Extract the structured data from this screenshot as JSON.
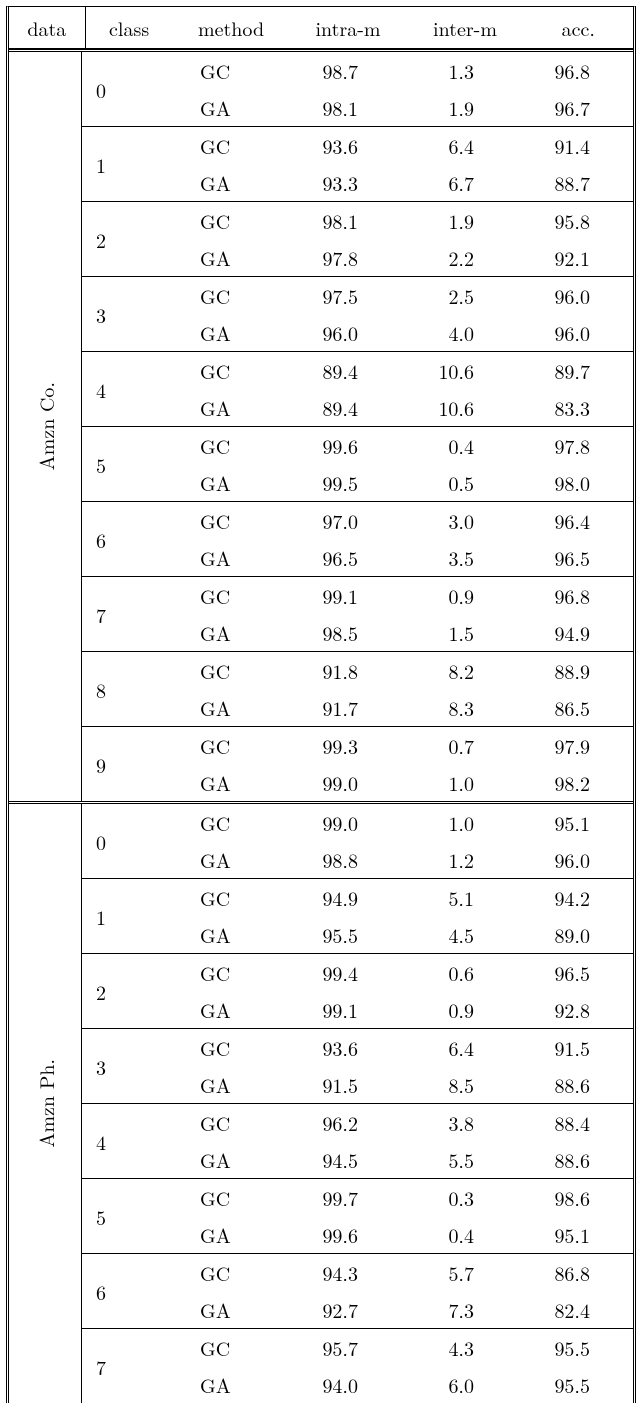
{
  "headers": {
    "data": "data",
    "class": "class",
    "method": "method",
    "intram": "intra-m",
    "interm": "inter-m",
    "acc": "acc."
  },
  "chart_data": {
    "type": "table",
    "sections": [
      {
        "data_label": "Amzn Co.",
        "groups": [
          {
            "class": "0",
            "rows": [
              {
                "method": "GC",
                "intram": "98.7",
                "interm": "1.3",
                "acc": "96.8"
              },
              {
                "method": "GA",
                "intram": "98.1",
                "interm": "1.9",
                "acc": "96.7"
              }
            ]
          },
          {
            "class": "1",
            "rows": [
              {
                "method": "GC",
                "intram": "93.6",
                "interm": "6.4",
                "acc": "91.4"
              },
              {
                "method": "GA",
                "intram": "93.3",
                "interm": "6.7",
                "acc": "88.7"
              }
            ]
          },
          {
            "class": "2",
            "rows": [
              {
                "method": "GC",
                "intram": "98.1",
                "interm": "1.9",
                "acc": "95.8"
              },
              {
                "method": "GA",
                "intram": "97.8",
                "interm": "2.2",
                "acc": "92.1"
              }
            ]
          },
          {
            "class": "3",
            "rows": [
              {
                "method": "GC",
                "intram": "97.5",
                "interm": "2.5",
                "acc": "96.0"
              },
              {
                "method": "GA",
                "intram": "96.0",
                "interm": "4.0",
                "acc": "96.0"
              }
            ]
          },
          {
            "class": "4",
            "rows": [
              {
                "method": "GC",
                "intram": "89.4",
                "interm": "10.6",
                "acc": "89.7"
              },
              {
                "method": "GA",
                "intram": "89.4",
                "interm": "10.6",
                "acc": "83.3"
              }
            ]
          },
          {
            "class": "5",
            "rows": [
              {
                "method": "GC",
                "intram": "99.6",
                "interm": "0.4",
                "acc": "97.8"
              },
              {
                "method": "GA",
                "intram": "99.5",
                "interm": "0.5",
                "acc": "98.0"
              }
            ]
          },
          {
            "class": "6",
            "rows": [
              {
                "method": "GC",
                "intram": "97.0",
                "interm": "3.0",
                "acc": "96.4"
              },
              {
                "method": "GA",
                "intram": "96.5",
                "interm": "3.5",
                "acc": "96.5"
              }
            ]
          },
          {
            "class": "7",
            "rows": [
              {
                "method": "GC",
                "intram": "99.1",
                "interm": "0.9",
                "acc": "96.8"
              },
              {
                "method": "GA",
                "intram": "98.5",
                "interm": "1.5",
                "acc": "94.9"
              }
            ]
          },
          {
            "class": "8",
            "rows": [
              {
                "method": "GC",
                "intram": "91.8",
                "interm": "8.2",
                "acc": "88.9"
              },
              {
                "method": "GA",
                "intram": "91.7",
                "interm": "8.3",
                "acc": "86.5"
              }
            ]
          },
          {
            "class": "9",
            "rows": [
              {
                "method": "GC",
                "intram": "99.3",
                "interm": "0.7",
                "acc": "97.9"
              },
              {
                "method": "GA",
                "intram": "99.0",
                "interm": "1.0",
                "acc": "98.2"
              }
            ]
          }
        ]
      },
      {
        "data_label": "Amzn Ph.",
        "groups": [
          {
            "class": "0",
            "rows": [
              {
                "method": "GC",
                "intram": "99.0",
                "interm": "1.0",
                "acc": "95.1"
              },
              {
                "method": "GA",
                "intram": "98.8",
                "interm": "1.2",
                "acc": "96.0"
              }
            ]
          },
          {
            "class": "1",
            "rows": [
              {
                "method": "GC",
                "intram": "94.9",
                "interm": "5.1",
                "acc": "94.2"
              },
              {
                "method": "GA",
                "intram": "95.5",
                "interm": "4.5",
                "acc": "89.0"
              }
            ]
          },
          {
            "class": "2",
            "rows": [
              {
                "method": "GC",
                "intram": "99.4",
                "interm": "0.6",
                "acc": "96.5"
              },
              {
                "method": "GA",
                "intram": "99.1",
                "interm": "0.9",
                "acc": "92.8"
              }
            ]
          },
          {
            "class": "3",
            "rows": [
              {
                "method": "GC",
                "intram": "93.6",
                "interm": "6.4",
                "acc": "91.5"
              },
              {
                "method": "GA",
                "intram": "91.5",
                "interm": "8.5",
                "acc": "88.6"
              }
            ]
          },
          {
            "class": "4",
            "rows": [
              {
                "method": "GC",
                "intram": "96.2",
                "interm": "3.8",
                "acc": "88.4"
              },
              {
                "method": "GA",
                "intram": "94.5",
                "interm": "5.5",
                "acc": "88.6"
              }
            ]
          },
          {
            "class": "5",
            "rows": [
              {
                "method": "GC",
                "intram": "99.7",
                "interm": "0.3",
                "acc": "98.6"
              },
              {
                "method": "GA",
                "intram": "99.6",
                "interm": "0.4",
                "acc": "95.1"
              }
            ]
          },
          {
            "class": "6",
            "rows": [
              {
                "method": "GC",
                "intram": "94.3",
                "interm": "5.7",
                "acc": "86.8"
              },
              {
                "method": "GA",
                "intram": "92.7",
                "interm": "7.3",
                "acc": "82.4"
              }
            ]
          },
          {
            "class": "7",
            "rows": [
              {
                "method": "GC",
                "intram": "95.7",
                "interm": "4.3",
                "acc": "95.5"
              },
              {
                "method": "GA",
                "intram": "94.0",
                "interm": "6.0",
                "acc": "95.5"
              }
            ]
          }
        ]
      }
    ]
  }
}
